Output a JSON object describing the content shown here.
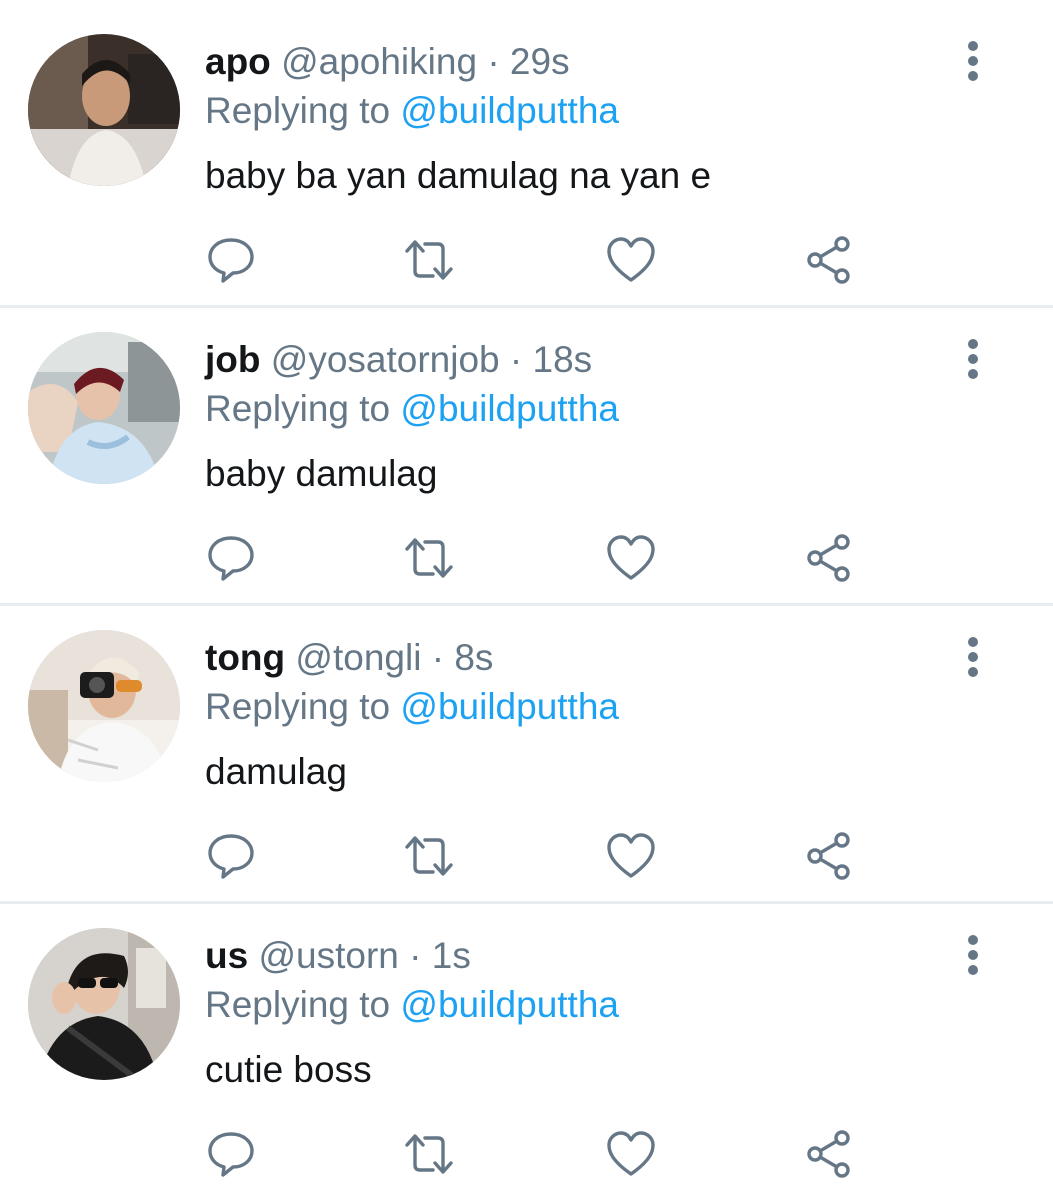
{
  "colors": {
    "name": "#14171a",
    "secondary": "#657786",
    "mention": "#1da1f2",
    "divider": "#e6ecf0"
  },
  "replies": [
    {
      "name": "apo",
      "handle": "@apohiking",
      "separator": "·",
      "time": "29s",
      "replying_prefix": "Replying to",
      "replying_to": "@buildputtha",
      "text": "baby ba yan damulag na yan e",
      "icons": [
        "reply-icon",
        "retweet-icon",
        "like-icon",
        "share-icon",
        "more-vertical-icon"
      ]
    },
    {
      "name": "job",
      "handle": "@yosatornjob",
      "separator": "·",
      "time": "18s",
      "replying_prefix": "Replying to",
      "replying_to": "@buildputtha",
      "text": "baby damulag",
      "icons": [
        "reply-icon",
        "retweet-icon",
        "like-icon",
        "share-icon",
        "more-vertical-icon"
      ]
    },
    {
      "name": "tong",
      "handle": "@tongli",
      "separator": "·",
      "time": "8s",
      "replying_prefix": "Replying to",
      "replying_to": "@buildputtha",
      "text": "damulag",
      "icons": [
        "reply-icon",
        "retweet-icon",
        "like-icon",
        "share-icon",
        "more-vertical-icon"
      ]
    },
    {
      "name": "us",
      "handle": "@ustorn",
      "separator": "·",
      "time": "1s",
      "replying_prefix": "Replying to",
      "replying_to": "@buildputtha",
      "text": "cutie boss",
      "icons": [
        "reply-icon",
        "retweet-icon",
        "like-icon",
        "share-icon",
        "more-vertical-icon"
      ]
    }
  ]
}
